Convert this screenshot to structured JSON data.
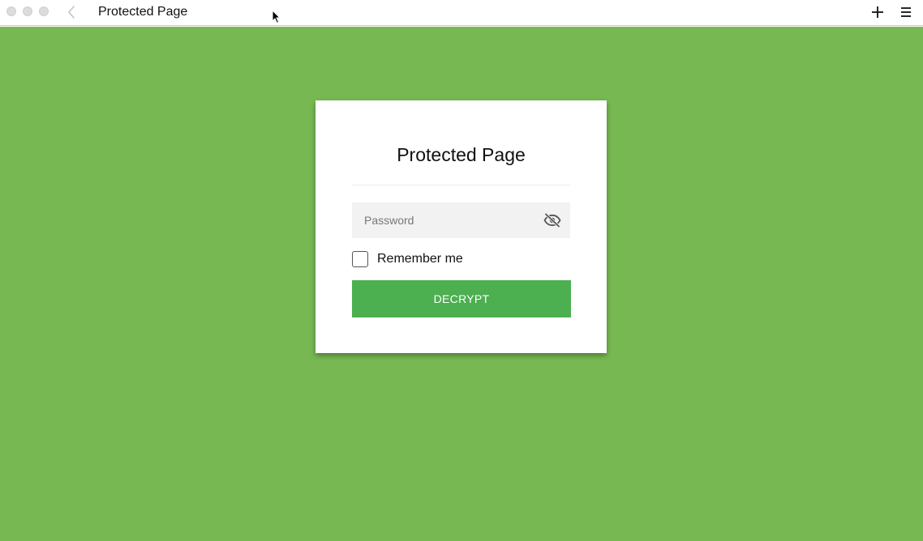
{
  "window": {
    "title": "Protected Page"
  },
  "toolbar": {
    "back_icon": "chevron-left-icon",
    "new_tab_icon": "plus-icon",
    "menu_icon": "hamburger-menu-icon"
  },
  "page": {
    "background_color": "#77b852",
    "card": {
      "title": "Protected Page",
      "password": {
        "placeholder": "Password",
        "value": "",
        "toggle_icon": "eye-slash-icon"
      },
      "remember": {
        "label": "Remember me",
        "checked": false
      },
      "submit_label": "DECRYPT",
      "submit_color": "#4caf50"
    }
  }
}
